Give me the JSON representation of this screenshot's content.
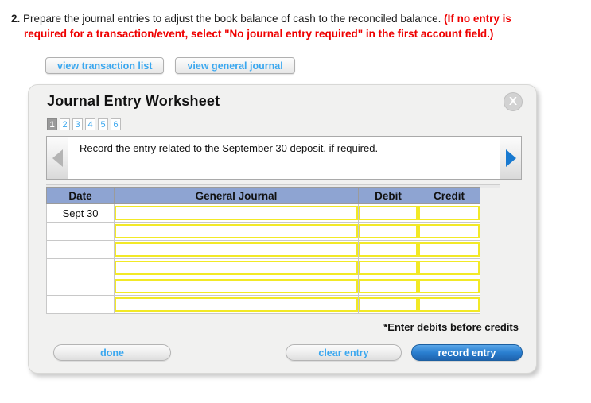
{
  "question": {
    "number": "2.",
    "line1": "Prepare the journal entries to adjust the book balance of cash to the reconciled balance.",
    "warning1": "(If no entry is",
    "warning2": "required for a transaction/event, select \"No journal entry required\" in the first account field.)"
  },
  "top_buttons": {
    "view_transaction_list": "view transaction list",
    "view_general_journal": "view general journal"
  },
  "panel": {
    "title": "Journal Entry Worksheet",
    "close_label": "X",
    "pager": [
      {
        "label": "1",
        "active": true
      },
      {
        "label": "2",
        "active": false
      },
      {
        "label": "3",
        "active": false
      },
      {
        "label": "4",
        "active": false
      },
      {
        "label": "5",
        "active": false
      },
      {
        "label": "6",
        "active": false
      }
    ],
    "instruction": "Record the entry related to the September 30 deposit, if required.",
    "nav_prev_icon": "triangle-left-icon",
    "nav_next_icon": "triangle-right-icon",
    "debits_note": "*Enter debits before credits"
  },
  "table": {
    "headers": [
      "Date",
      "General Journal",
      "Debit",
      "Credit"
    ],
    "rows": [
      {
        "date": "Sept 30",
        "general_journal": "",
        "debit": "",
        "credit": ""
      },
      {
        "date": "",
        "general_journal": "",
        "debit": "",
        "credit": ""
      },
      {
        "date": "",
        "general_journal": "",
        "debit": "",
        "credit": ""
      },
      {
        "date": "",
        "general_journal": "",
        "debit": "",
        "credit": ""
      },
      {
        "date": "",
        "general_journal": "",
        "debit": "",
        "credit": ""
      },
      {
        "date": "",
        "general_journal": "",
        "debit": "",
        "credit": ""
      }
    ]
  },
  "footer_buttons": {
    "done": "done",
    "clear_entry": "clear entry",
    "record_entry": "record entry"
  },
  "colors": {
    "link_blue": "#3aa7ef",
    "warning_red": "#ee0000",
    "header_blue": "#8ea4d2",
    "field_yellow": "#f2e926",
    "record_blue": "#2a7fd0"
  }
}
